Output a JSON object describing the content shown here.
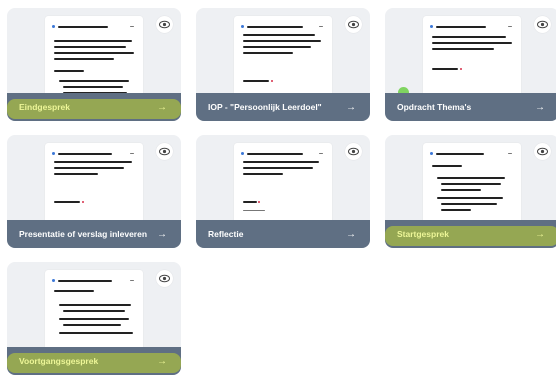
{
  "cards": [
    {
      "title": "Eindgesprek",
      "arrow": "→"
    },
    {
      "title": "IOP - \"Persoonlijk Leerdoel\"",
      "arrow": "→"
    },
    {
      "title": "Opdracht Thema's",
      "arrow": "→"
    },
    {
      "title": "Presentatie of verslag inleveren",
      "arrow": "→"
    },
    {
      "title": "Reflectie",
      "arrow": "→"
    },
    {
      "title": "Startgesprek",
      "arrow": "→"
    },
    {
      "title": "Voortgangsgesprek",
      "arrow": "→"
    }
  ],
  "colors": {
    "footer": "#5f6f83",
    "highlight": "#d6ec18",
    "card_background": "#eef0f3"
  }
}
